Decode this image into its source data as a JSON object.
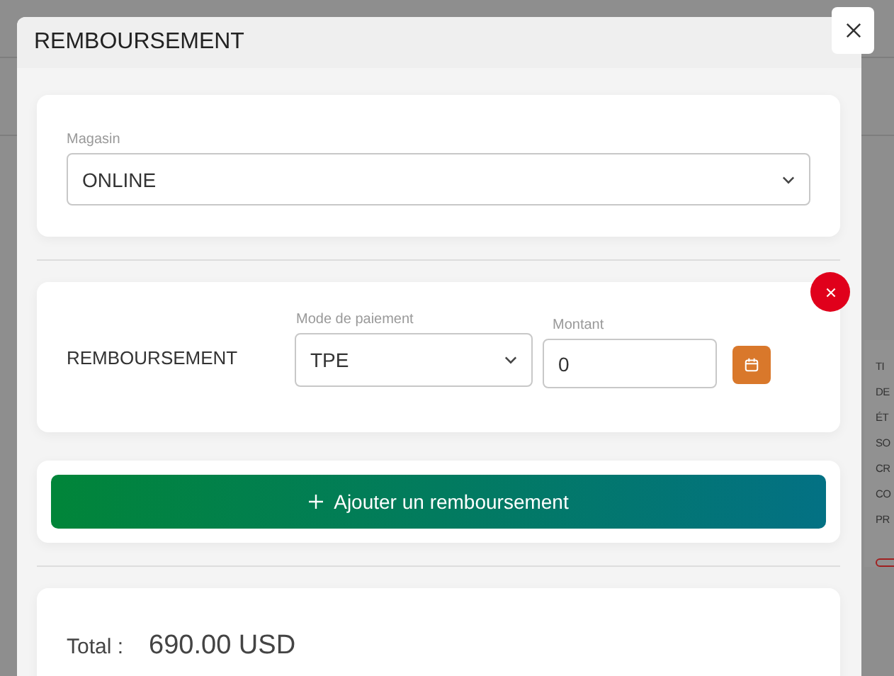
{
  "background": {
    "side_labels": [
      "TI",
      "DE",
      "ÉT",
      "SO",
      "CR",
      "CO",
      "PR"
    ]
  },
  "modal": {
    "title": "REMBOURSEMENT",
    "store": {
      "label": "Magasin",
      "value": "ONLINE"
    },
    "refunds": [
      {
        "label": "REMBOURSEMENT",
        "payment": {
          "label": "Mode de paiement",
          "value": "TPE"
        },
        "amount": {
          "label": "Montant",
          "value": "0"
        }
      }
    ],
    "add_button": "Ajouter un remboursement",
    "total": {
      "label": "Total :",
      "value": "690.00 USD"
    }
  }
}
